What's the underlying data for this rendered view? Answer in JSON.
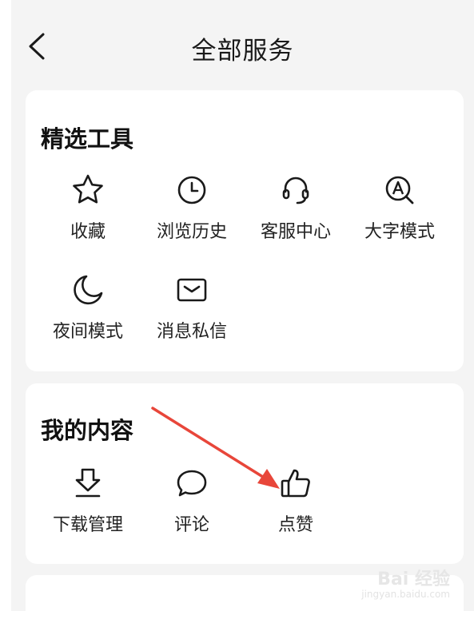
{
  "header": {
    "title": "全部服务"
  },
  "sections": [
    {
      "title": "精选工具",
      "items": [
        {
          "label": "收藏",
          "icon": "star-icon"
        },
        {
          "label": "浏览历史",
          "icon": "clock-icon"
        },
        {
          "label": "客服中心",
          "icon": "headset-icon"
        },
        {
          "label": "大字模式",
          "icon": "magnifier-a-icon"
        },
        {
          "label": "夜间模式",
          "icon": "moon-icon"
        },
        {
          "label": "消息私信",
          "icon": "envelope-icon"
        }
      ]
    },
    {
      "title": "我的内容",
      "items": [
        {
          "label": "下载管理",
          "icon": "download-icon"
        },
        {
          "label": "评论",
          "icon": "comment-icon"
        },
        {
          "label": "点赞",
          "icon": "thumbs-up-icon"
        }
      ]
    }
  ],
  "watermark": {
    "brand": "Bai 经验",
    "url": "jingyan.baidu.com"
  },
  "colors": {
    "annotation_arrow": "#e8463a",
    "card_bg": "#ffffff",
    "page_bg": "#f4f4f4"
  }
}
